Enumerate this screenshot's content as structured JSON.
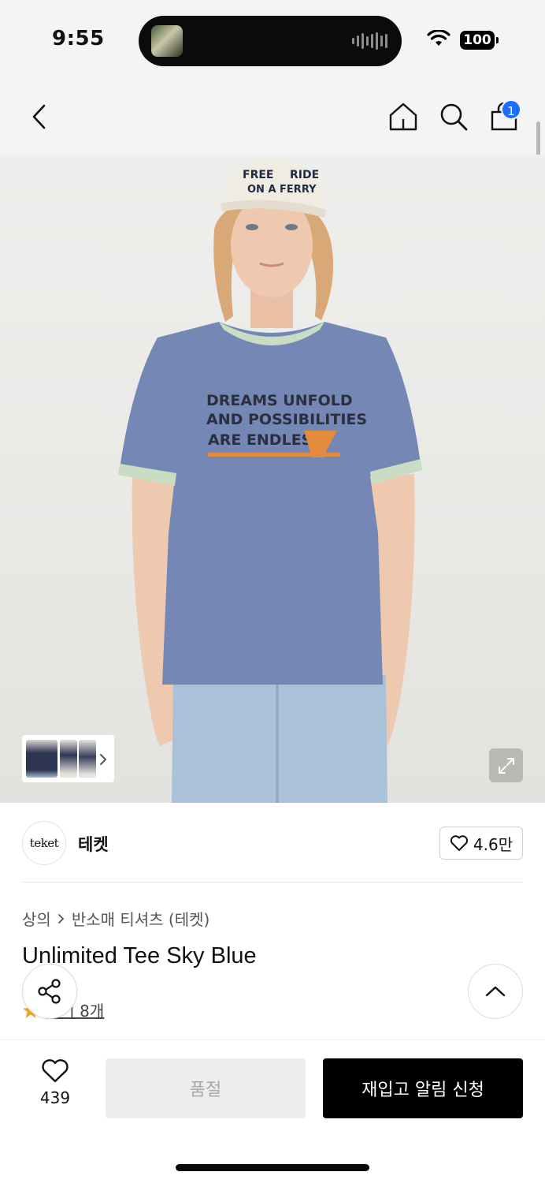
{
  "status_bar": {
    "time": "9:55",
    "battery": "100"
  },
  "nav": {
    "back_icon": "chevron-left-icon",
    "home_icon": "home-icon",
    "search_icon": "search-icon",
    "cart_icon": "shopping-bag-icon",
    "cart_count": "1",
    "badge_color": "#1a6dff"
  },
  "product_image": {
    "shirt_text": [
      "DREAMS UNFOLD",
      "AND POSSIBILITIES",
      "ARE ENDLESS"
    ],
    "cap_text": [
      "FREE",
      "RIDE",
      "ON A FERRY"
    ],
    "expand_icon": "expand-icon",
    "thumbnail_arrow_icon": "chevron-right-icon"
  },
  "brand": {
    "logo_text": "teket",
    "name": "테켓",
    "likes": "4.6만"
  },
  "breadcrumb": {
    "category": "상의",
    "subcategory": "반소매 티셔츠 (테켓)"
  },
  "product": {
    "title": "Unlimited Tee Sky Blue",
    "review_link": "후기 8개",
    "star_color": "#f4a62a"
  },
  "bottom_bar": {
    "wishlist_count": "439",
    "soldout_label": "품절",
    "restock_label": "재입고 알림 신청"
  }
}
